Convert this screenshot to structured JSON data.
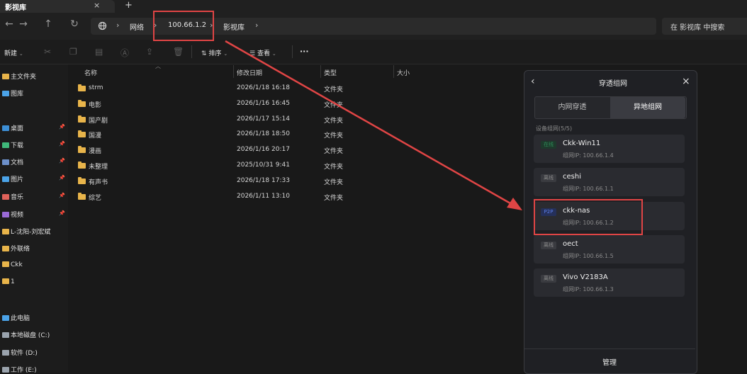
{
  "window": {
    "title": "影视库",
    "close_icon": "×",
    "new_tab_icon": "+"
  },
  "nav": {
    "icons": [
      "←",
      "→",
      "↑",
      "↻"
    ],
    "breadcrumb": [
      "网络",
      "100.66.1.2",
      "影视库"
    ],
    "search_placeholder": "在 影视库 中搜索"
  },
  "toolbar": {
    "new_label": "新建",
    "sort_label": "排序",
    "view_label": "查看",
    "more_icon": "···"
  },
  "sidebar": {
    "items": [
      {
        "label": "主文件夹",
        "icon": "home-icon",
        "color": "#e8b44a",
        "pinned": false
      },
      {
        "label": "图库",
        "icon": "gallery-icon",
        "color": "#4ba3e8",
        "pinned": false
      },
      {
        "label": "桌面",
        "icon": "desktop-icon",
        "color": "#3d8fd6",
        "pinned": true
      },
      {
        "label": "下载",
        "icon": "download-icon",
        "color": "#3fb87a",
        "pinned": true
      },
      {
        "label": "文档",
        "icon": "documents-icon",
        "color": "#6c8fc9",
        "pinned": true
      },
      {
        "label": "图片",
        "icon": "pictures-icon",
        "color": "#4ba3e8",
        "pinned": true
      },
      {
        "label": "音乐",
        "icon": "music-icon",
        "color": "#e0625a",
        "pinned": true
      },
      {
        "label": "视频",
        "icon": "videos-icon",
        "color": "#9a6ad6",
        "pinned": true
      },
      {
        "label": "L-沈阳-刘宏斌",
        "icon": "folder-icon",
        "color": "#e8b44a",
        "pinned": false
      },
      {
        "label": "外联络",
        "icon": "folder-icon",
        "color": "#e8b44a",
        "pinned": false
      },
      {
        "label": "Ckk",
        "icon": "folder-icon",
        "color": "#e8b44a",
        "pinned": false
      },
      {
        "label": "1",
        "icon": "folder-icon",
        "color": "#e8b44a",
        "pinned": false
      },
      {
        "label": "此电脑",
        "icon": "pc-icon",
        "color": "#4ba3e8",
        "pinned": false
      },
      {
        "label": "本地磁盘 (C:)",
        "icon": "drive-icon",
        "color": "#9aa3ad",
        "pinned": false
      },
      {
        "label": "软件 (D:)",
        "icon": "drive-icon",
        "color": "#9aa3ad",
        "pinned": false
      },
      {
        "label": "工作 (E:)",
        "icon": "drive-icon",
        "color": "#9aa3ad",
        "pinned": false
      }
    ]
  },
  "filelist": {
    "columns": [
      "名称",
      "修改日期",
      "类型",
      "大小"
    ],
    "rows": [
      {
        "name": "strm",
        "date": "2026/1/18 16:18",
        "type": "文件夹"
      },
      {
        "name": "电影",
        "date": "2026/1/16 16:45",
        "type": "文件夹"
      },
      {
        "name": "国产剧",
        "date": "2026/1/17 15:14",
        "type": "文件夹"
      },
      {
        "name": "国漫",
        "date": "2026/1/18 18:50",
        "type": "文件夹"
      },
      {
        "name": "漫画",
        "date": "2026/1/16 20:17",
        "type": "文件夹"
      },
      {
        "name": "未整理",
        "date": "2025/10/31 9:41",
        "type": "文件夹"
      },
      {
        "name": "有声书",
        "date": "2026/1/18 17:33",
        "type": "文件夹"
      },
      {
        "name": "综艺",
        "date": "2026/1/11 13:10",
        "type": "文件夹"
      }
    ]
  },
  "panel": {
    "title": "穿透组网",
    "back_icon": "‹",
    "close_icon": "×",
    "tabs": [
      "内网穿透",
      "异地组网"
    ],
    "device_count": "设备组网(5/5)",
    "devices": [
      {
        "status": "在线",
        "status_color": "#2e8a57",
        "status_bg": "#1e3a2c",
        "name": "Ckk-Win11",
        "ip": "组网IP: 100.66.1.4"
      },
      {
        "status": "离线",
        "status_color": "#8a8a8a",
        "status_bg": "#3a3b40",
        "name": "ceshi",
        "ip": "组网IP: 100.66.1.1"
      },
      {
        "status": "P2P",
        "status_color": "#5a7de8",
        "status_bg": "#25305a",
        "name": "ckk-nas",
        "ip": "组网IP: 100.66.1.2"
      },
      {
        "status": "离线",
        "status_color": "#8a8a8a",
        "status_bg": "#3a3b40",
        "name": "oect",
        "ip": "组网IP: 100.66.1.5"
      },
      {
        "status": "离线",
        "status_color": "#8a8a8a",
        "status_bg": "#3a3b40",
        "name": "Vivo V2183A",
        "ip": "组网IP: 100.66.1.3"
      }
    ],
    "footer_label": "管理"
  },
  "colors": {
    "annotation": "#e04545",
    "accent": "#4ba3e8"
  }
}
